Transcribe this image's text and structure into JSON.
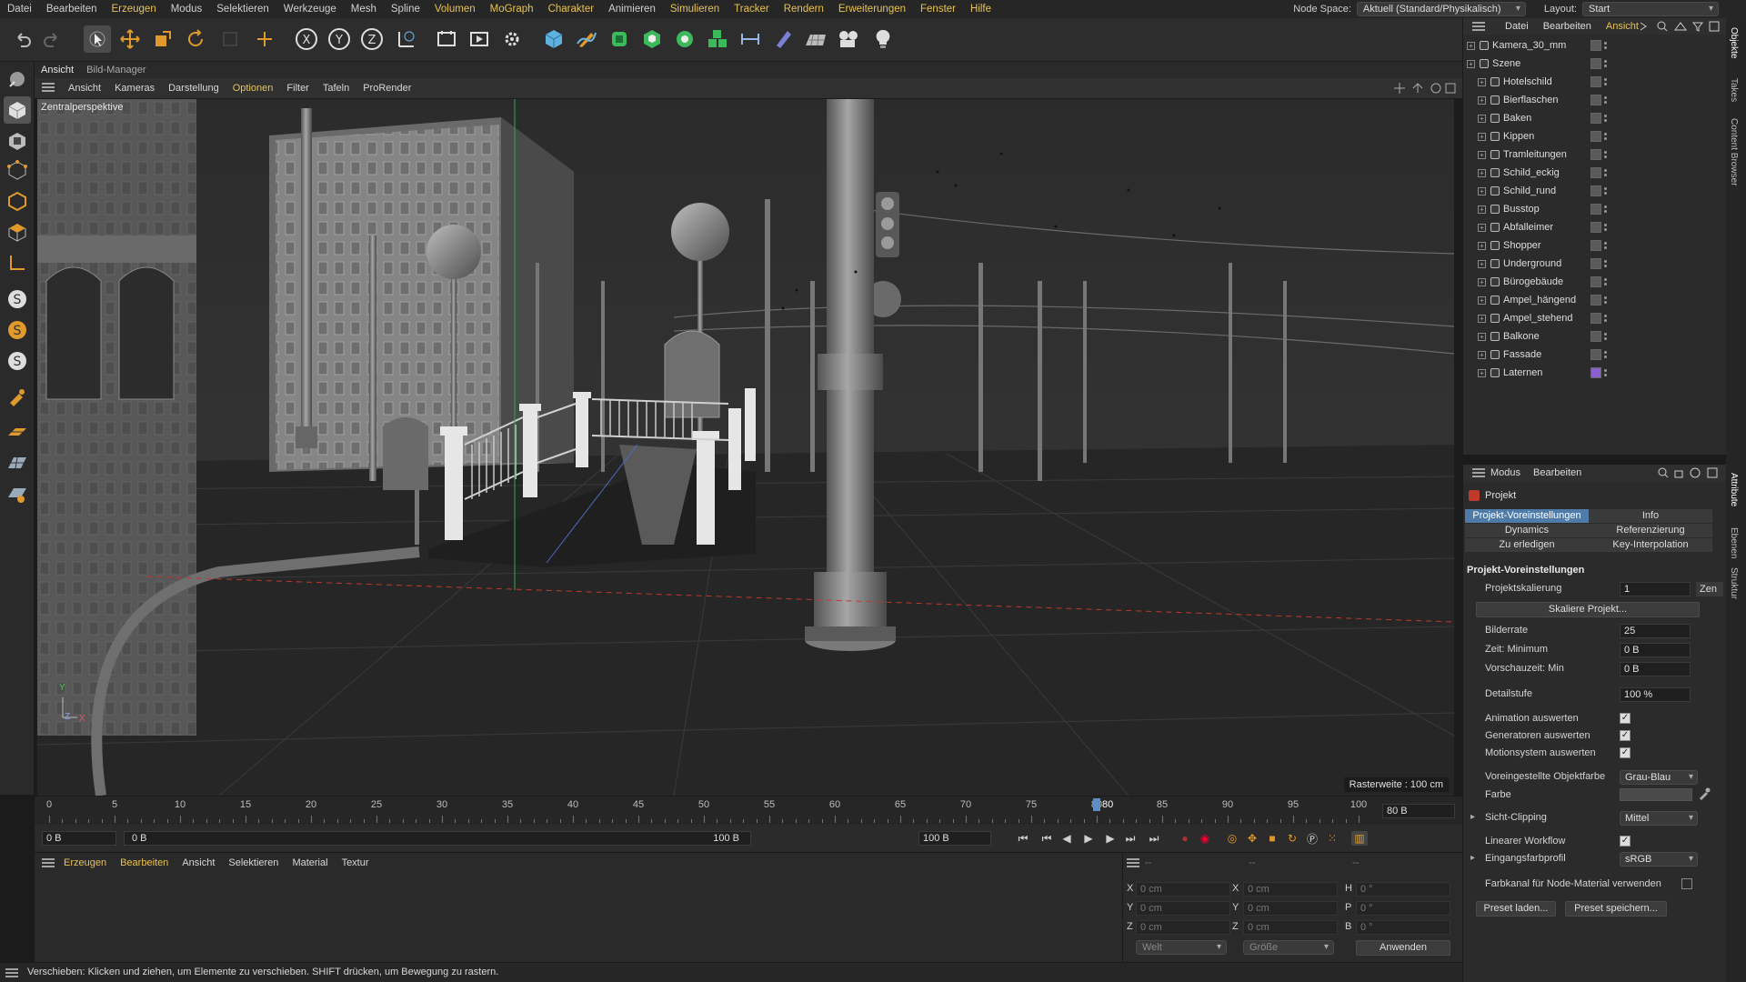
{
  "menu": [
    "Datei",
    "Bearbeiten",
    "Erzeugen",
    "Modus",
    "Selektieren",
    "Werkzeuge",
    "Mesh",
    "Spline",
    "Volumen",
    "MoGraph",
    "Charakter",
    "Animieren",
    "Simulieren",
    "Tracker",
    "Rendern",
    "Erweiterungen",
    "Fenster",
    "Hilfe"
  ],
  "node_space": {
    "label": "Node Space:",
    "value": "Aktuell (Standard/Physikalisch)"
  },
  "layout": {
    "label": "Layout:",
    "value": "Start"
  },
  "toolbar_icons": [
    "undo-icon",
    "redo-icon",
    "select-icon",
    "move-icon",
    "scale-icon",
    "rotate-icon",
    "transform-icon",
    "last-tool-icon",
    "x-axis-icon",
    "y-axis-icon",
    "z-axis-icon",
    "world-coords-icon",
    "render-view-icon",
    "render-picture-viewer-icon",
    "render-settings-icon",
    "cube-icon",
    "pen-icon",
    "subdivision-icon",
    "extrude-icon",
    "cloner-icon",
    "fracture-icon",
    "deformer-icon",
    "field-icon",
    "floor-icon",
    "camera-icon",
    "light-icon"
  ],
  "viewport": {
    "tabs": [
      "Ansicht",
      "Bild-Manager"
    ],
    "menu": [
      "Ansicht",
      "Kameras",
      "Darstellung",
      "Optionen",
      "Filter",
      "Tafeln",
      "ProRender"
    ],
    "label": "Zentralperspektive",
    "raster": "Rasterweite : 100 cm",
    "axis": {
      "y": "Y",
      "z": "Z",
      "x": "X"
    }
  },
  "timeline": {
    "ticks": [
      "0",
      "5",
      "10",
      "15",
      "20",
      "25",
      "30",
      "35",
      "40",
      "45",
      "50",
      "55",
      "60",
      "65",
      "70",
      "75",
      "80",
      "85",
      "90",
      "95",
      "100"
    ],
    "current_frame_label": "80",
    "frame_field": "80 B",
    "current": 80,
    "max": 100
  },
  "playbar": {
    "start": "0 B",
    "preview_start": "0 B",
    "preview_end": "100 B",
    "end": "100 B"
  },
  "material_manager": {
    "menu": [
      "Erzeugen",
      "Bearbeiten",
      "Ansicht",
      "Selektieren",
      "Material",
      "Textur"
    ]
  },
  "coordinates": {
    "header": [
      "--",
      "--",
      "--"
    ],
    "rows": [
      {
        "a": "X",
        "av": "0 cm",
        "b": "X",
        "bv": "0 cm",
        "c": "H",
        "cv": "0 °"
      },
      {
        "a": "Y",
        "av": "0 cm",
        "b": "Y",
        "bv": "0 cm",
        "c": "P",
        "cv": "0 °"
      },
      {
        "a": "Z",
        "av": "0 cm",
        "b": "Z",
        "bv": "0 cm",
        "c": "B",
        "cv": "0 °"
      }
    ],
    "mode1": "Welt",
    "mode2": "Größe",
    "apply": "Anwenden"
  },
  "status": "Verschieben: Klicken und ziehen, um Elemente zu verschieben. SHIFT drücken, um Bewegung zu rastern.",
  "object_manager": {
    "menu": [
      "Datei",
      "Bearbeiten",
      "Ansicht"
    ],
    "objects": [
      {
        "name": "Kamera_30_mm",
        "level": 0
      },
      {
        "name": "Szene",
        "level": 0
      },
      {
        "name": "Hotelschild",
        "level": 1
      },
      {
        "name": "Bierflaschen",
        "level": 1
      },
      {
        "name": "Baken",
        "level": 1
      },
      {
        "name": "Kippen",
        "level": 1
      },
      {
        "name": "Tramleitungen",
        "level": 1
      },
      {
        "name": "Schild_eckig",
        "level": 1
      },
      {
        "name": "Schild_rund",
        "level": 1
      },
      {
        "name": "Busstop",
        "level": 1
      },
      {
        "name": "Abfalleimer",
        "level": 1
      },
      {
        "name": "Shopper",
        "level": 1
      },
      {
        "name": "Underground",
        "level": 1
      },
      {
        "name": "Bürogebäude",
        "level": 1
      },
      {
        "name": "Ampel_hängend",
        "level": 1
      },
      {
        "name": "Ampel_stehend",
        "level": 1
      },
      {
        "name": "Balkone",
        "level": 1
      },
      {
        "name": "Fassade",
        "level": 1
      },
      {
        "name": "Laternen",
        "level": 1
      }
    ]
  },
  "attributes": {
    "menu": [
      "Modus",
      "Bearbeiten"
    ],
    "object": "Projekt",
    "tabs": [
      [
        "Projekt-Voreinstellungen",
        "Info"
      ],
      [
        "Dynamics",
        "Referenzierung"
      ],
      [
        "Zu erledigen",
        "Key-Interpolation"
      ]
    ],
    "section": "Projekt-Voreinstellungen",
    "project_scale_label": "Projektskalierung",
    "project_scale_value": "1",
    "project_scale_unit": "Zen",
    "scale_button": "Skaliere Projekt...",
    "fields": [
      {
        "label": "Bilderrate",
        "value": "25"
      },
      {
        "label": "Zeit: Minimum",
        "value": "0 B"
      },
      {
        "label": "Vorschauzeit: Min",
        "value": "0 B"
      },
      {
        "label": "Detailstufe",
        "value": "100 %"
      }
    ],
    "checks": [
      {
        "label": "Animation auswerten",
        "checked": true
      },
      {
        "label": "Generatoren auswerten",
        "checked": true
      },
      {
        "label": "Motionsystem auswerten",
        "checked": true
      }
    ],
    "obj_color_label": "Voreingestellte Objektfarbe",
    "obj_color_value": "Grau-Blau",
    "color_label": "Farbe",
    "clipping_label": "Sicht-Clipping",
    "clipping_value": "Mittel",
    "linear_label": "Linearer Workflow",
    "input_profile_label": "Eingangsfarbprofil",
    "input_profile_value": "sRGB",
    "node_material_label": "Farbkanal für Node-Material verwenden",
    "preset_load": "Preset laden...",
    "preset_save": "Preset speichern..."
  },
  "side_tabs": [
    "Objekte",
    "Takes",
    "Content Browser",
    "Attribute",
    "Ebenen",
    "Struktur"
  ],
  "colors": {
    "accent": "#e7c253",
    "selection": "#4f7ba8",
    "green_axis": "#3fa34d",
    "red_axis": "#c0392b"
  }
}
